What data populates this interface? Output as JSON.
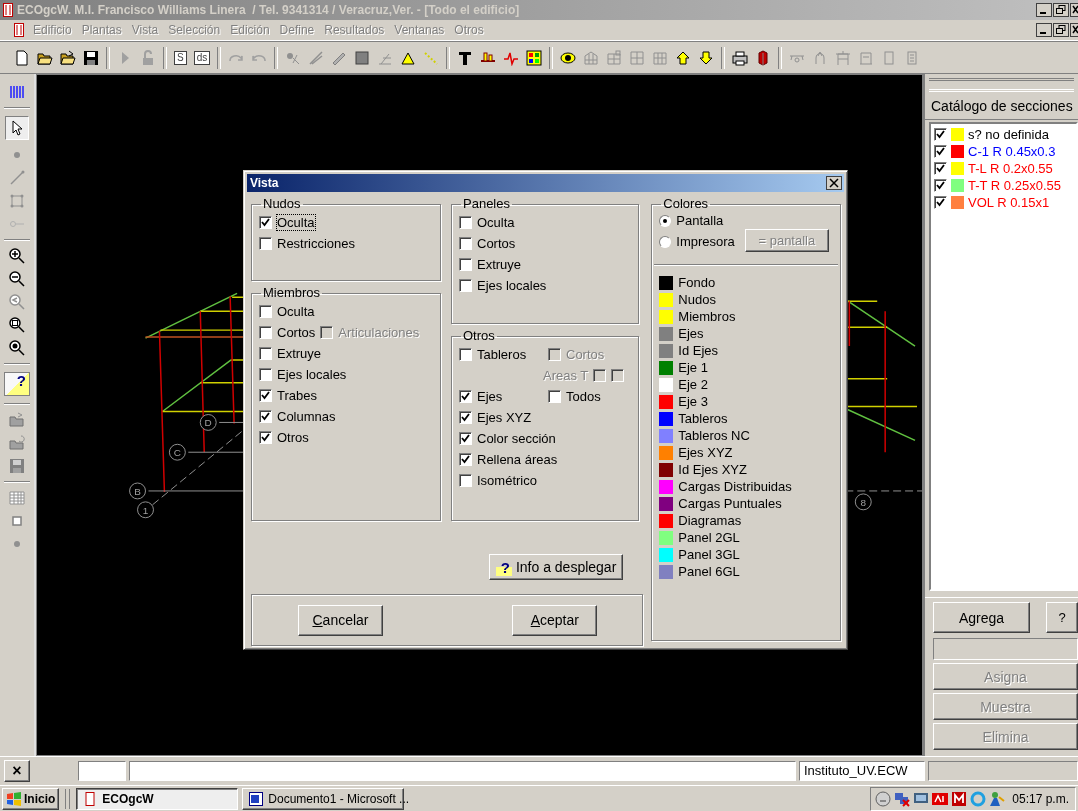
{
  "window": {
    "title": "ECOgcW. M.I. Francisco Williams Linera  / Tel. 9341314 / Veracruz,Ver. - [Todo el edificio]"
  },
  "menu": [
    {
      "label": "Edificio",
      "disabled": true
    },
    {
      "label": "Plantas",
      "disabled": true
    },
    {
      "label": "Vista",
      "disabled": true
    },
    {
      "label": "Selección",
      "disabled": true
    },
    {
      "label": "Edición",
      "disabled": true
    },
    {
      "label": "Define",
      "disabled": true
    },
    {
      "label": "Resultados",
      "disabled": true
    },
    {
      "label": "Ventanas",
      "disabled": true
    },
    {
      "label": "Otros",
      "disabled": true
    }
  ],
  "toolbar_labels": [
    "S",
    "ds"
  ],
  "left_toolbar": {
    "help_glyph": "?"
  },
  "canvas": {
    "axis_labels": [
      "D",
      "C",
      "B",
      "1",
      "8"
    ]
  },
  "dialog": {
    "title": "Vista",
    "groups": [
      {
        "title": "Nudos",
        "rows": [
          {
            "kind": "single",
            "items": [
              {
                "label": "Oculta",
                "checked": true,
                "disabled": false
              }
            ]
          },
          {
            "kind": "single",
            "items": [
              {
                "label": "Restricciones",
                "checked": false,
                "disabled": false
              }
            ]
          }
        ]
      },
      {
        "title": "Miembros",
        "rows": [
          {
            "kind": "single",
            "items": [
              {
                "label": "Oculta",
                "checked": false,
                "disabled": false
              }
            ]
          },
          {
            "kind": "inline",
            "items": [
              {
                "label": "Cortos",
                "checked": false,
                "disabled": false
              },
              {
                "label": "Articulaciones",
                "checked": false,
                "disabled": true
              }
            ]
          },
          {
            "kind": "single",
            "items": [
              {
                "label": "Extruye",
                "checked": false,
                "disabled": false
              }
            ]
          },
          {
            "kind": "single",
            "items": [
              {
                "label": "Ejes locales",
                "checked": false,
                "disabled": false
              }
            ]
          },
          {
            "kind": "single",
            "items": [
              {
                "label": "Trabes",
                "checked": true,
                "disabled": false
              }
            ]
          },
          {
            "kind": "single",
            "items": [
              {
                "label": "Columnas",
                "checked": true,
                "disabled": false
              }
            ]
          },
          {
            "kind": "single",
            "items": [
              {
                "label": "Otros",
                "checked": true,
                "disabled": false
              }
            ]
          }
        ]
      },
      {
        "title": "Paneles",
        "rows": [
          {
            "kind": "single",
            "items": [
              {
                "label": "Oculta",
                "checked": false,
                "disabled": false
              }
            ]
          },
          {
            "kind": "single",
            "items": [
              {
                "label": "Cortos",
                "checked": false,
                "disabled": false
              }
            ]
          },
          {
            "kind": "single",
            "items": [
              {
                "label": "Extruye",
                "checked": false,
                "disabled": false
              }
            ]
          },
          {
            "kind": "single",
            "items": [
              {
                "label": "Ejes locales",
                "checked": false,
                "disabled": false
              }
            ]
          }
        ]
      },
      {
        "title": "Otros",
        "rows": [
          {
            "kind": "pair",
            "items": [
              {
                "label": "Tableros",
                "checked": false,
                "disabled": false
              },
              {
                "label": "Cortos",
                "checked": false,
                "disabled": true
              }
            ]
          },
          {
            "kind": "sub",
            "items": [
              {
                "label": "Areas T",
                "checked": false,
                "disabled": true
              },
              {
                "checked": false,
                "disabled": true
              }
            ]
          },
          {
            "kind": "pair",
            "items": [
              {
                "label": "Ejes",
                "checked": true,
                "disabled": false
              },
              {
                "label": "Todos",
                "checked": false,
                "disabled": false
              }
            ]
          },
          {
            "kind": "single",
            "items": [
              {
                "label": "Ejes XYZ",
                "checked": true,
                "disabled": false
              }
            ]
          },
          {
            "kind": "single",
            "items": [
              {
                "label": "Color sección",
                "checked": true,
                "disabled": false
              }
            ]
          },
          {
            "kind": "single",
            "items": [
              {
                "label": "Rellena áreas",
                "checked": true,
                "disabled": false
              }
            ]
          },
          {
            "kind": "single",
            "items": [
              {
                "label": "Isométrico",
                "checked": false,
                "disabled": false
              }
            ]
          }
        ]
      }
    ],
    "info_button": {
      "glyph": "?",
      "label": "Info a desplegar"
    },
    "buttons": [
      {
        "label": "Cancelar"
      },
      {
        "label": "Aceptar"
      }
    ],
    "colors": {
      "title": "Colores",
      "radios": [
        {
          "label": "Pantalla",
          "selected": true
        },
        {
          "label": "Impresora",
          "selected": false
        }
      ],
      "copy_button": {
        "label": "= pantalla",
        "disabled": true
      },
      "items": [
        {
          "label": "Fondo",
          "color": "#000000"
        },
        {
          "label": "Nudos",
          "color": "#ffff00"
        },
        {
          "label": "Miembros",
          "color": "#ffff00"
        },
        {
          "label": "Ejes",
          "color": "#808080"
        },
        {
          "label": "Id Ejes",
          "color": "#808080"
        },
        {
          "label": "Eje 1",
          "color": "#008000"
        },
        {
          "label": "Eje 2",
          "color": "#ffffff"
        },
        {
          "label": "Eje 3",
          "color": "#ff0000"
        },
        {
          "label": "Tableros",
          "color": "#0000ff"
        },
        {
          "label": "Tableros NC",
          "color": "#8080ff"
        },
        {
          "label": "Ejes XYZ",
          "color": "#ff8000"
        },
        {
          "label": "Id Ejes XYZ",
          "color": "#800000"
        },
        {
          "label": "Cargas Distribuidas",
          "color": "#ff00ff"
        },
        {
          "label": "Cargas Puntuales",
          "color": "#800080"
        },
        {
          "label": "Diagramas",
          "color": "#ff0000"
        },
        {
          "label": "Panel 2GL",
          "color": "#80ff80"
        },
        {
          "label": "Panel 3GL",
          "color": "#00ffff"
        },
        {
          "label": "Panel 6GL",
          "color": "#8080c0"
        }
      ]
    }
  },
  "catalog": {
    "title": "Catálogo de secciones",
    "sections": [
      {
        "checked": true,
        "swatch": {
          "color": "#ffff00"
        },
        "label": {
          "text": "s?  no definida",
          "color": "#000000"
        }
      },
      {
        "checked": true,
        "swatch": {
          "color": "#ff0000"
        },
        "label": {
          "text": "C-1 R 0.45x0.3",
          "color": "#0000ff"
        }
      },
      {
        "checked": true,
        "swatch": {
          "color": "#ffff00"
        },
        "label": {
          "text": "T-L R 0.2x0.55",
          "color": "#ff0000"
        }
      },
      {
        "checked": true,
        "swatch": {
          "color": "#80ff80"
        },
        "label": {
          "text": "T-T R 0.25x0.55",
          "color": "#ff0000"
        }
      },
      {
        "checked": true,
        "swatch": {
          "color": "#ff8040"
        },
        "label": {
          "text": "VOL R 0.15x1",
          "color": "#ff0000"
        }
      }
    ],
    "add_button": "Agrega",
    "help_button": "?",
    "actions": [
      {
        "label": "Asigna",
        "disabled": true
      },
      {
        "label": "Muestra",
        "disabled": true
      },
      {
        "label": "Elimina",
        "disabled": true
      }
    ]
  },
  "status_bar": {
    "close_glyph": "×",
    "file": "Instituto_UV.ECW"
  },
  "taskbar": {
    "start": "Inicio",
    "tasks": [
      {
        "label": "ECOgcW",
        "selected": true
      },
      {
        "label": "Documento1 - Microsoft ...",
        "selected": false
      }
    ],
    "clock": "05:17 p.m."
  }
}
